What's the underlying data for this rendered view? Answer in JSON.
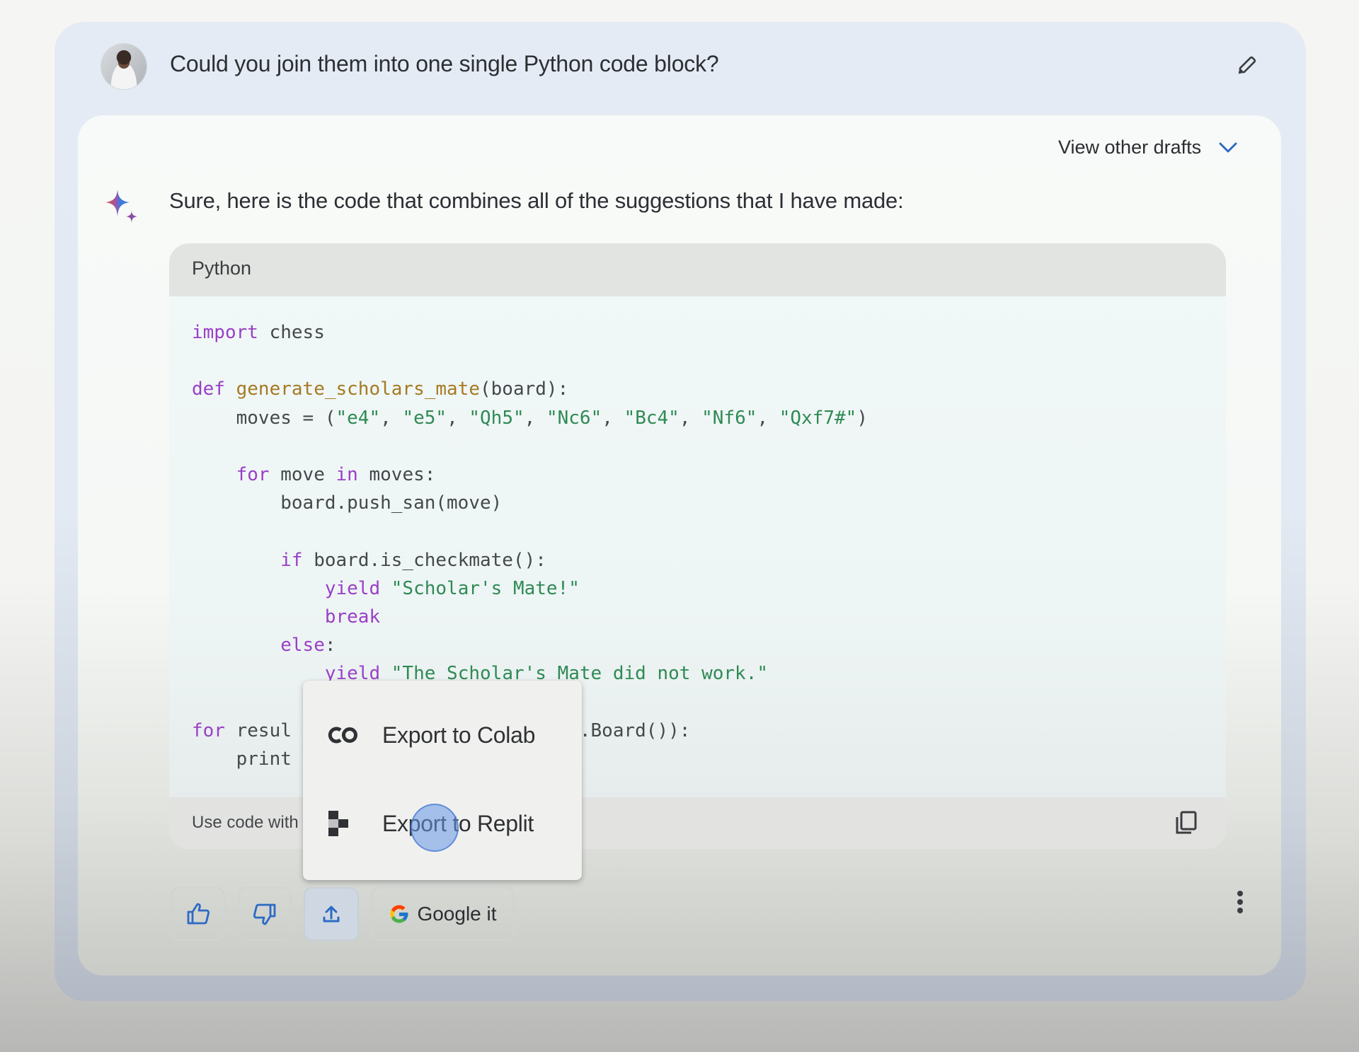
{
  "user_prompt": {
    "avatar": "user-avatar",
    "text": "Could you join them into one single Python code block?",
    "edit_icon": "pencil-icon"
  },
  "response": {
    "drafts_label": "View other drafts",
    "drafts_icon": "chevron-down-icon",
    "assistant_icon": "sparkle-icon",
    "intro": "Sure, here is the code that combines all of the suggestions that I have made:",
    "code_block": {
      "language": "Python",
      "lines": [
        [
          {
            "t": "import",
            "c": "kw"
          },
          {
            "t": " chess",
            "c": ""
          }
        ],
        [],
        [
          {
            "t": "def",
            "c": "kw"
          },
          {
            "t": " ",
            "c": ""
          },
          {
            "t": "generate_scholars_mate",
            "c": "fn"
          },
          {
            "t": "(board):",
            "c": ""
          }
        ],
        [
          {
            "t": "    moves = (",
            "c": ""
          },
          {
            "t": "\"e4\"",
            "c": "str"
          },
          {
            "t": ", ",
            "c": ""
          },
          {
            "t": "\"e5\"",
            "c": "str"
          },
          {
            "t": ", ",
            "c": ""
          },
          {
            "t": "\"Qh5\"",
            "c": "str"
          },
          {
            "t": ", ",
            "c": ""
          },
          {
            "t": "\"Nc6\"",
            "c": "str"
          },
          {
            "t": ", ",
            "c": ""
          },
          {
            "t": "\"Bc4\"",
            "c": "str"
          },
          {
            "t": ", ",
            "c": ""
          },
          {
            "t": "\"Nf6\"",
            "c": "str"
          },
          {
            "t": ", ",
            "c": ""
          },
          {
            "t": "\"Qxf7#\"",
            "c": "str"
          },
          {
            "t": ")",
            "c": ""
          }
        ],
        [],
        [
          {
            "t": "    ",
            "c": ""
          },
          {
            "t": "for",
            "c": "kw"
          },
          {
            "t": " move ",
            "c": ""
          },
          {
            "t": "in",
            "c": "kw"
          },
          {
            "t": " moves:",
            "c": ""
          }
        ],
        [
          {
            "t": "        board.push_san(move)",
            "c": ""
          }
        ],
        [],
        [
          {
            "t": "        ",
            "c": ""
          },
          {
            "t": "if",
            "c": "kw"
          },
          {
            "t": " board.is_checkmate():",
            "c": ""
          }
        ],
        [
          {
            "t": "            ",
            "c": ""
          },
          {
            "t": "yield",
            "c": "kw"
          },
          {
            "t": " ",
            "c": ""
          },
          {
            "t": "\"Scholar's Mate!\"",
            "c": "str"
          }
        ],
        [
          {
            "t": "            ",
            "c": ""
          },
          {
            "t": "break",
            "c": "kw"
          }
        ],
        [
          {
            "t": "        ",
            "c": ""
          },
          {
            "t": "else",
            "c": "kw"
          },
          {
            "t": ":",
            "c": ""
          }
        ],
        [
          {
            "t": "            ",
            "c": ""
          },
          {
            "t": "yield",
            "c": "kw"
          },
          {
            "t": " ",
            "c": ""
          },
          {
            "t": "\"The Scholar's Mate did not work.\"",
            "c": "str"
          }
        ],
        [],
        [
          {
            "t": "for",
            "c": "kw"
          },
          {
            "t": " resul",
            "c": ""
          },
          {
            "t": "                 ",
            "c": ""
          },
          {
            "t": "ate(chess.Board()):",
            "c": ""
          }
        ],
        [
          {
            "t": "    print",
            "c": ""
          }
        ]
      ],
      "footer_text": "Use code with",
      "copy_icon": "copy-icon"
    },
    "export_menu": {
      "items": [
        {
          "icon": "colab-icon",
          "label": "Export to Colab"
        },
        {
          "icon": "replit-icon",
          "label": "Export to Replit"
        }
      ]
    },
    "actions": {
      "thumbs_up": "thumbs-up-icon",
      "thumbs_down": "thumbs-down-icon",
      "share": "share-icon",
      "google_it_label": "Google it",
      "more": "more-vert-icon"
    }
  },
  "colors": {
    "accent_blue": "#2d6bc4",
    "keyword": "#9a3fc7",
    "function": "#a57a22",
    "string": "#2f8a54"
  }
}
